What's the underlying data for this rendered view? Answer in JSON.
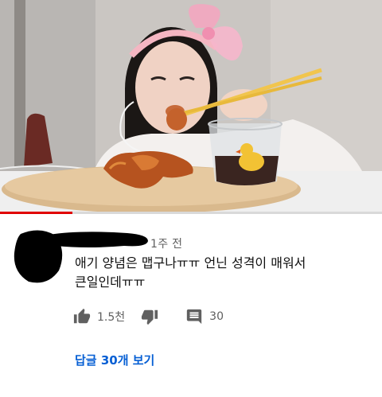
{
  "video": {
    "progress_fraction": 0.19
  },
  "comment": {
    "timestamp": "1주 전",
    "text_line1": "애기 양념은 맵구나ㅠㅠ 언닌 성격이 매워서",
    "text_line2": "큰일인데ㅠㅠ",
    "like_count": "1.5천",
    "reply_count": "30",
    "view_replies_label": "답글 30개 보기"
  },
  "colors": {
    "link_blue": "#065fd4",
    "progress_red": "#e00000",
    "secondary_text": "#606060"
  }
}
